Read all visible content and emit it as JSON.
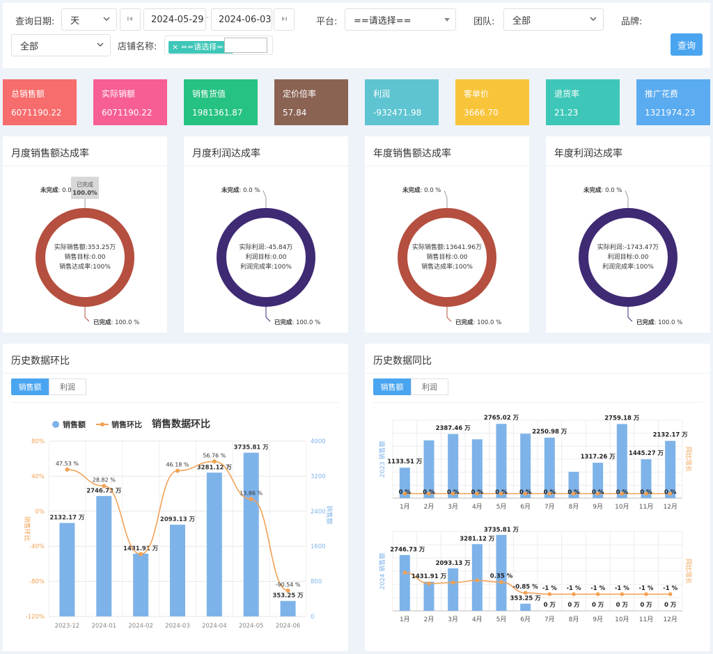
{
  "filter": {
    "date_label": "查询日期:",
    "granularity": "天",
    "start_date": "2024-05-29",
    "separator": "-",
    "end_date": "2024-06-03",
    "platform_label": "平台:",
    "platform_value": "==请选择==",
    "team_label": "团队:",
    "team_value": "全部",
    "brand_label": "品牌:",
    "brand_value": "全部",
    "store_label": "店铺名称:",
    "store_tag": "× ==请选择==",
    "query_button": "查询"
  },
  "kpis": [
    {
      "label": "总销售额",
      "value": "6071190.22",
      "color": "#f76c6c"
    },
    {
      "label": "实际销额",
      "value": "6071190.22",
      "color": "#f65e94"
    },
    {
      "label": "销售货值",
      "value": "1981361.87",
      "color": "#26c281"
    },
    {
      "label": "定价倍率",
      "value": "57.84",
      "color": "#8b6353"
    },
    {
      "label": "利润",
      "value": "-932471.98",
      "color": "#5ec4d1"
    },
    {
      "label": "客单价",
      "value": "3666.70",
      "color": "#f8c43a"
    },
    {
      "label": "退货率",
      "value": "21.23",
      "color": "#3ec7b8"
    },
    {
      "label": "推广花费",
      "value": "1321974.23",
      "color": "#5aabf0"
    }
  ],
  "donuts": [
    {
      "title": "月度销售额达成率",
      "color": "#b54f3f",
      "lines": [
        "实际销售额:353.25万",
        "销售目标:0.00",
        "销售达成率:100%"
      ],
      "unfinished": "未完成",
      "unfinished_val": ": 0.0",
      "done": "已完成",
      "done_val": ": 100.0 %",
      "tooltip_label": "已完成",
      "tooltip_val": "100.0%",
      "done_fraction": 1.0
    },
    {
      "title": "月度利润达成率",
      "color": "#3f2a74",
      "lines": [
        "实际利润:-45.84万",
        "利润目标:0.00",
        "利润完成率:100%"
      ],
      "unfinished": "未完成",
      "unfinished_val": ": 0.0 %",
      "done": "已完成",
      "done_val": ": 100.0 %",
      "done_fraction": 1.0
    },
    {
      "title": "年度销售额达成率",
      "color": "#b54f3f",
      "lines": [
        "实际销售额:13641.96万",
        "销售目标:0.00",
        "销售达成率:100%"
      ],
      "unfinished": "未完成",
      "unfinished_val": ": 0.0 %",
      "done": "已完成",
      "done_val": ": 100.0 %",
      "done_fraction": 1.0
    },
    {
      "title": "年度利润达成率",
      "color": "#3f2a74",
      "lines": [
        "实际利润:-1743.47万",
        "利润目标:0.00",
        "利润完成率:100%"
      ],
      "unfinished": "未完成",
      "unfinished_val": ": 0.0 %",
      "done": "已完成",
      "done_val": ": 100.0 %",
      "done_fraction": 1.0
    }
  ],
  "history_mom": {
    "title": "历史数据环比",
    "tabs": [
      "销售额",
      "利润"
    ]
  },
  "history_yoy": {
    "title": "历史数据同比",
    "tabs": [
      "销售额",
      "利润"
    ]
  },
  "colors": {
    "bar": "#7eb3e9",
    "line": "#f1a154",
    "axis_left": "#f1a154",
    "axis_right": "#7eb3e9"
  },
  "chart_data": [
    {
      "type": "bar",
      "title": "销售数据环比",
      "legend": [
        "销售额",
        "销售环比"
      ],
      "categories": [
        "2023-12",
        "2024-01",
        "2024-02",
        "2024-03",
        "2024-04",
        "2024-05",
        "2024-06"
      ],
      "series": [
        {
          "name": "销售额",
          "values": [
            2132.17,
            2746.73,
            1431.91,
            2093.13,
            3281.12,
            3735.81,
            353.25
          ],
          "labels": [
            "2132.17 万",
            "2746.73 万",
            "1431.91 万",
            "2093.13 万",
            "3281.12 万",
            "3735.81 万",
            "353.25 万"
          ]
        },
        {
          "name": "销售环比",
          "values": [
            47.53,
            28.82,
            -48.87,
            46.18,
            56.76,
            13.86,
            -90.54
          ],
          "labels": [
            "47.53 %",
            "28.82 %",
            "",
            "46.18 %",
            "56.76 %",
            "13.86 %",
            "-90.54 %"
          ]
        }
      ],
      "ylabel_left": "销售环比",
      "ylabel_right": "销售额",
      "yleft_ticks": [
        "80%",
        "40%",
        "0%",
        "-40%",
        "-80%",
        "-120%"
      ],
      "yright_ticks": [
        "4000",
        "3200",
        "2400",
        "1600",
        "800",
        "0"
      ],
      "ylim_left": [
        -120,
        80
      ],
      "ylim_right": [
        0,
        4000
      ]
    },
    {
      "type": "bar",
      "categories": [
        "1月",
        "2月",
        "3月",
        "4月",
        "5月",
        "6月",
        "7月",
        "8月",
        "9月",
        "10月",
        "11月",
        "12月"
      ],
      "series": [
        {
          "name": "2023 销售额",
          "values": [
            1133.51,
            2150,
            2387.46,
            2190,
            2765.02,
            2400,
            2250.98,
            980,
            1317.26,
            2759.18,
            1445.27,
            2132.17
          ],
          "labels": [
            "1133.51 万",
            "",
            "2387.46 万",
            "",
            "2765.02 万",
            "",
            "2250.98 万",
            "",
            "1317.26 万",
            "2759.18 万",
            "1445.27 万",
            "2132.17 万"
          ]
        },
        {
          "name": "同比",
          "values": [
            0,
            0,
            0,
            0,
            0,
            0,
            0,
            0,
            0,
            0,
            0,
            0
          ],
          "labels": [
            "0 %",
            "0 %",
            "0 %",
            "0 %",
            "0 %",
            "0 %",
            "0 %",
            "0 %",
            "0 %",
            "0 %",
            "0 %",
            "0 %"
          ]
        }
      ],
      "ylabel_left": "2023 销售额",
      "ylabel_right": "同比增长",
      "ylim": [
        0,
        2900
      ]
    },
    {
      "type": "bar",
      "categories": [
        "1月",
        "2月",
        "3月",
        "4月",
        "5月",
        "6月",
        "7月",
        "8月",
        "9月",
        "10月",
        "11月",
        "12月"
      ],
      "series": [
        {
          "name": "2024 销售额",
          "values": [
            2746.73,
            1431.91,
            2093.13,
            3281.12,
            3735.81,
            353.25,
            0,
            0,
            0,
            0,
            0,
            0
          ],
          "labels": [
            "2746.73 万",
            "1431.91 万",
            "2093.13 万",
            "3281.12 万",
            "3735.81 万",
            "353.25 万",
            "0 万",
            "0 万",
            "0 万",
            "0 万",
            "0 万",
            "0 万"
          ]
        },
        {
          "name": "同比",
          "values": [
            1.42,
            0.2,
            0.3,
            0.55,
            0.35,
            -0.85,
            -1,
            -1,
            -1,
            -1,
            -1,
            -1
          ],
          "labels": [
            "",
            "",
            "",
            "",
            "0.35 %",
            "-0.85 %",
            "-1 %",
            "-1 %",
            "-1 %",
            "-1 %",
            "-1 %",
            "-1 %"
          ]
        }
      ],
      "ylabel_left": "2024 销售额",
      "ylabel_right": "同比增长",
      "ylim": [
        0,
        3900
      ]
    }
  ]
}
